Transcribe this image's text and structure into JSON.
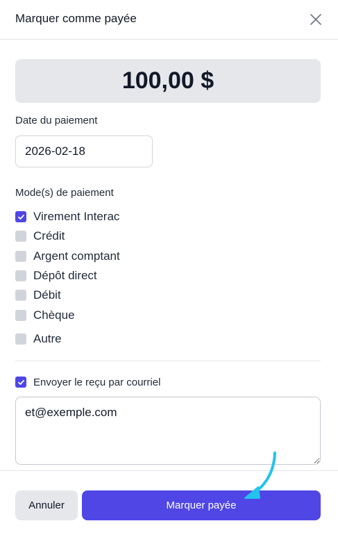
{
  "dialog": {
    "title": "Marquer comme payée",
    "amount": "100,00 $"
  },
  "payment_date": {
    "label": "Date du paiement",
    "value": "2026-02-18"
  },
  "payment_modes": {
    "label": "Mode(s) de paiement",
    "options": [
      {
        "label": "Virement Interac",
        "checked": true
      },
      {
        "label": "Crédit",
        "checked": false
      },
      {
        "label": "Argent comptant",
        "checked": false
      },
      {
        "label": "Dépôt direct",
        "checked": false
      },
      {
        "label": "Débit",
        "checked": false
      },
      {
        "label": "Chèque",
        "checked": false
      },
      {
        "label": "Autre",
        "checked": false
      }
    ]
  },
  "email_receipt": {
    "label": "Envoyer le reçu par courriel",
    "checked": true,
    "email": "et@exemple.com"
  },
  "footer": {
    "cancel_label": "Annuler",
    "confirm_label": "Marquer payée"
  },
  "colors": {
    "accent": "#4f46e5",
    "annotation_arrow": "#22c3ee"
  },
  "icons": {
    "close": "close-icon",
    "calendar": "calendar-icon",
    "check": "checkmark-icon"
  }
}
